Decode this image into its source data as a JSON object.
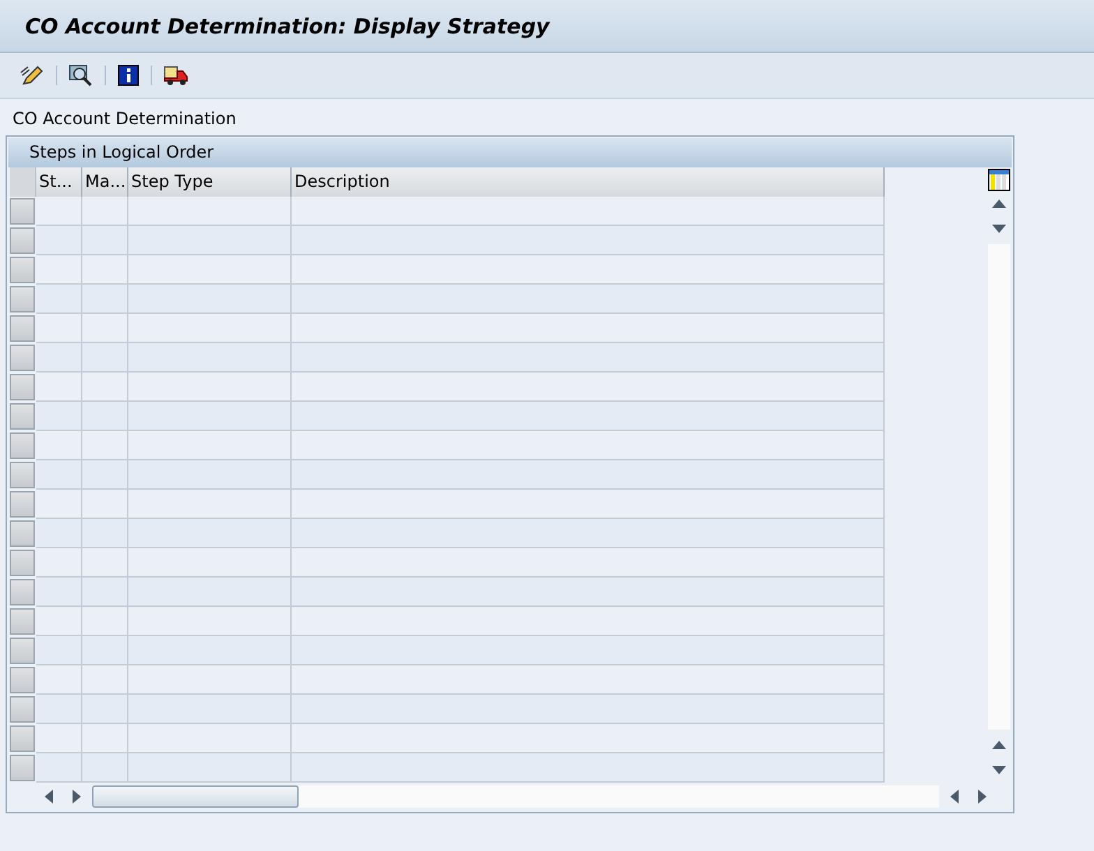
{
  "window": {
    "title": "CO Account Determination: Display Strategy"
  },
  "section_label": "CO Account Determination",
  "table": {
    "title": "Steps in Logical Order",
    "columns": [
      "St...",
      "Ma...",
      "Step Type",
      "Description"
    ]
  }
}
